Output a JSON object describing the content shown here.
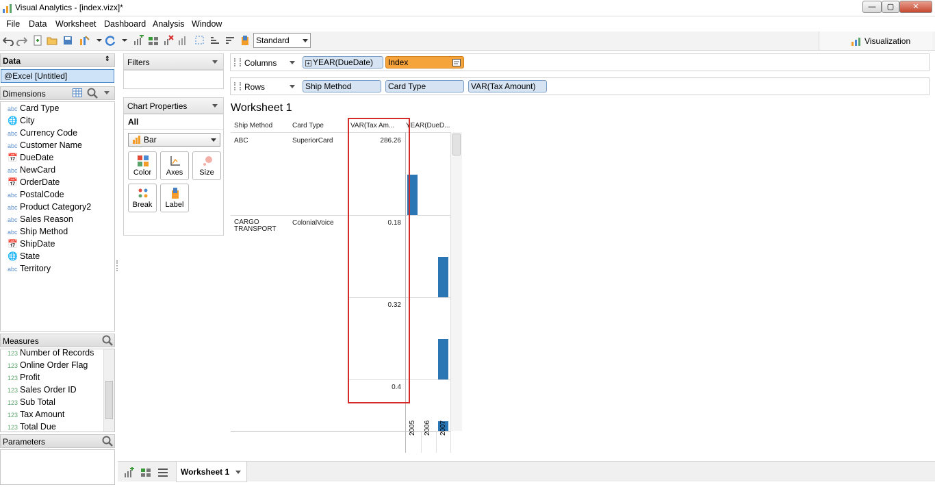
{
  "window": {
    "title": "Visual Analytics - [index.vizx]*",
    "min": "—",
    "max": "▢",
    "close": "✕"
  },
  "menu": [
    "File",
    "Data",
    "Worksheet",
    "Dashboard",
    "Analysis",
    "Window"
  ],
  "toolbar": {
    "view_mode": "Standard",
    "visualization_label": "Visualization"
  },
  "data_pane": {
    "title": "Data",
    "datasource": "@Excel [Untitled]",
    "dimensions_label": "Dimensions",
    "dimensions": [
      {
        "icon": "abc",
        "name": "Card Type"
      },
      {
        "icon": "globe",
        "name": "City"
      },
      {
        "icon": "abc",
        "name": "Currency Code"
      },
      {
        "icon": "abc",
        "name": "Customer Name"
      },
      {
        "icon": "calendar",
        "name": "DueDate"
      },
      {
        "icon": "abc",
        "name": "NewCard"
      },
      {
        "icon": "calendar",
        "name": "OrderDate"
      },
      {
        "icon": "abc",
        "name": "PostalCode"
      },
      {
        "icon": "abc",
        "name": "Product Category2"
      },
      {
        "icon": "abc",
        "name": "Sales Reason"
      },
      {
        "icon": "abc",
        "name": "Ship Method"
      },
      {
        "icon": "calendar",
        "name": "ShipDate"
      },
      {
        "icon": "globe",
        "name": "State"
      },
      {
        "icon": "abc",
        "name": "Territory"
      }
    ],
    "measures_label": "Measures",
    "measures": [
      {
        "icon": "123",
        "name": "Number of Records"
      },
      {
        "icon": "123",
        "name": "Online Order Flag"
      },
      {
        "icon": "123",
        "name": "Profit"
      },
      {
        "icon": "123",
        "name": "Sales Order ID"
      },
      {
        "icon": "123",
        "name": "Sub Total"
      },
      {
        "icon": "123",
        "name": "Tax Amount"
      },
      {
        "icon": "123",
        "name": "Total Due"
      }
    ],
    "parameters_label": "Parameters"
  },
  "filters": {
    "title": "Filters"
  },
  "chart_properties": {
    "title": "Chart Properties",
    "scope": "All",
    "mark_type": "Bar",
    "buttons": [
      "Color",
      "Axes",
      "Size",
      "Break",
      "Label"
    ]
  },
  "shelves": {
    "columns_label": "Columns",
    "columns": [
      "YEAR(DueDate)",
      "Index"
    ],
    "rows_label": "Rows",
    "rows": [
      "Ship Method",
      "Card Type",
      "VAR(Tax Amount)"
    ]
  },
  "worksheet": {
    "title": "Worksheet 1",
    "headers": [
      "Ship Method",
      "Card Type",
      "VAR(Tax Am...",
      "YEAR(DueD..."
    ],
    "rows": [
      {
        "ship_method": "ABC",
        "card_type": "SuperiorCard",
        "var": "286.26"
      },
      {
        "ship_method": "CARGO\nTRANSPORT",
        "card_type": "ColonialVoice",
        "var": "0.18"
      },
      {
        "ship_method": "",
        "card_type": "",
        "var": "0.32"
      },
      {
        "ship_method": "",
        "card_type": "",
        "var": "0.4"
      }
    ],
    "years": [
      "2005",
      "2006",
      "2007"
    ]
  },
  "chart_data": {
    "type": "bar",
    "title": "Worksheet 1",
    "x_dimension": "YEAR(DueDate)",
    "categories": [
      "2005",
      "2006",
      "2007"
    ],
    "panes": [
      {
        "ship_method": "ABC",
        "card_type": "SuperiorCard",
        "var_tax_amount": 286.26,
        "year": "2005",
        "index": 1
      },
      {
        "ship_method": "CARGO TRANSPORT",
        "card_type": "ColonialVoice",
        "var_tax_amount": 0.18,
        "year": "2007",
        "index": 1
      },
      {
        "ship_method": "CARGO TRANSPORT",
        "card_type": "ColonialVoice",
        "var_tax_amount": 0.32,
        "year": "2007",
        "index": 1
      },
      {
        "ship_method": "CARGO TRANSPORT",
        "card_type": "ColonialVoice",
        "var_tax_amount": 0.4,
        "year": "2007",
        "index": 1
      }
    ],
    "bar_color": "#2a75b4"
  },
  "sheets": {
    "active": "Worksheet 1"
  },
  "colors": {
    "accent": "#2a75b4",
    "highlight": "#d42a2a",
    "index_pill": "#f5a33b"
  }
}
